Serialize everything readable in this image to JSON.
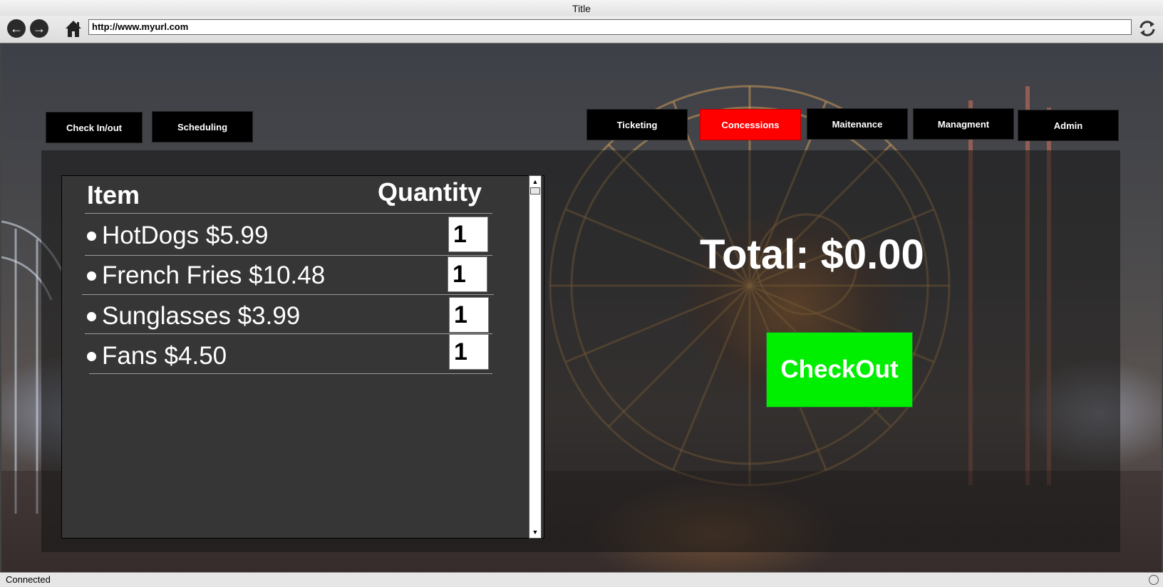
{
  "browser": {
    "title": "Title",
    "url": "http://www.myurl.com",
    "status": "Connected"
  },
  "nav": {
    "left_tabs": [
      "Check In/out",
      "Scheduling"
    ],
    "right_tabs": [
      "Ticketing",
      "Concessions",
      "Maitenance",
      "Managment",
      "Admin"
    ],
    "active": "Concessions"
  },
  "items_table": {
    "header_item": "Item",
    "header_quantity": "Quantity",
    "rows": [
      {
        "item": "HotDogs $5.99",
        "qty": "1"
      },
      {
        "item": "French Fries $10.48",
        "qty": "1"
      },
      {
        "item": "Sunglasses $3.99",
        "qty": "1"
      },
      {
        "item": "Fans $4.50",
        "qty": "1"
      }
    ]
  },
  "summary": {
    "total_label": "Total: $0.00",
    "checkout_label": "CheckOut"
  },
  "colors": {
    "active_tab": "#ff0000",
    "checkout": "#00ee00",
    "tab": "#000000"
  },
  "icons": [
    "back-arrow-icon",
    "forward-arrow-icon",
    "home-icon",
    "refresh-icon",
    "globe-icon"
  ]
}
